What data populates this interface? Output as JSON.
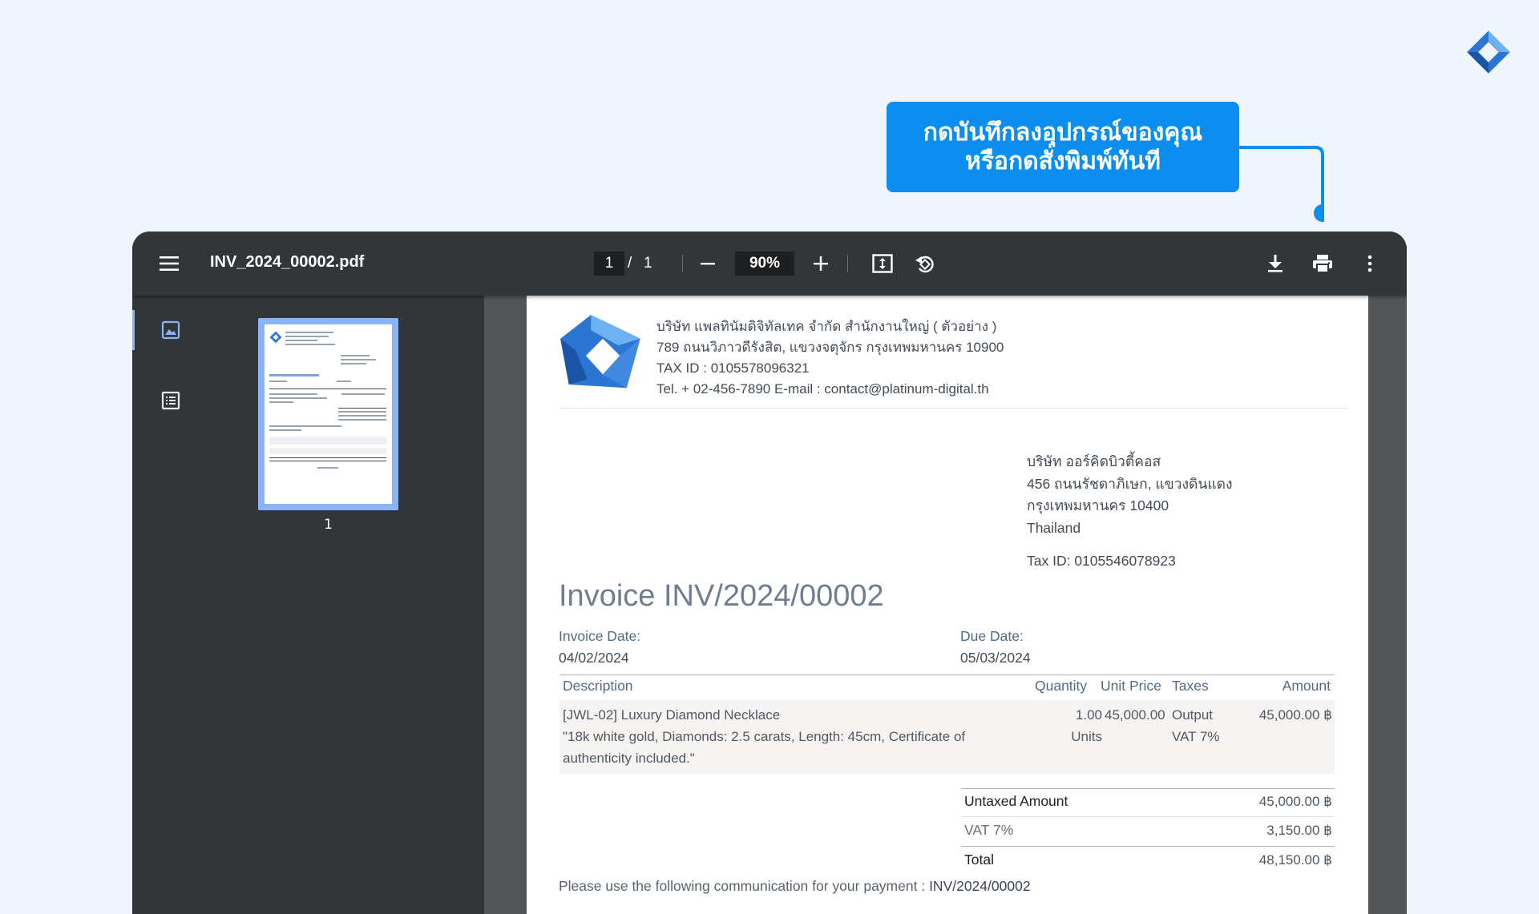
{
  "callout": {
    "line1": "กดบันทึกลงอุปกรณ์ของคุณ",
    "line2": "หรือกดสั่งพิมพ์ทันที"
  },
  "viewer": {
    "filename": "INV_2024_00002.pdf",
    "current_page": "1",
    "page_separator": "/",
    "total_pages": "1",
    "zoom": "90%",
    "thumbnail_label": "1"
  },
  "invoice": {
    "company": {
      "name": "บริษัท แพลทินัมดิจิทัลเทค จำกัด สำนักงานใหญ่ ( ตัวอย่าง )",
      "address": "789 ถนนวิภาวดีรังสิต, แขวงจตุจักร กรุงเทพมหานคร 10900",
      "tax": "TAX ID : 0105578096321",
      "contact": "Tel. + 02-456-7890  E-mail : contact@platinum-digital.th"
    },
    "customer": {
      "name": "บริษัท ออร์คิดบิวตี้คอส",
      "address1": "456 ถนนรัชดาภิเษก, แขวงดินแดง",
      "address2": "กรุงเทพมหานคร 10400",
      "country": "Thailand",
      "tax": "Tax ID: 0105546078923"
    },
    "title": "Invoice INV/2024/00002",
    "invoice_date_label": "Invoice Date:",
    "invoice_date": "04/02/2024",
    "due_date_label": "Due Date:",
    "due_date": "05/03/2024",
    "columns": {
      "description": "Description",
      "quantity": "Quantity",
      "unit_price": "Unit Price",
      "taxes": "Taxes",
      "amount": "Amount"
    },
    "line": {
      "desc1": "[JWL-02] Luxury Diamond Necklace",
      "desc2": "\"18k white gold, Diamonds: 2.5 carats, Length: 45cm, Certificate of",
      "desc3": "authenticity included.\"",
      "qty": "1.00",
      "qty_unit": "Units",
      "unit_price": "45,000.00",
      "tax1": "Output",
      "tax2": "VAT 7%",
      "amount": "45,000.00 ฿"
    },
    "totals": {
      "untaxed_label": "Untaxed Amount",
      "untaxed": "45,000.00 ฿",
      "vat_label": "VAT 7%",
      "vat": "3,150.00 ฿",
      "total_label": "Total",
      "total": "48,150.00 ฿"
    },
    "payment_note": "Please use the following communication for your payment :",
    "payment_ref": "INV/2024/00002"
  },
  "colors": {
    "accent": "#0b8ef0",
    "viewer_bg": "#323639",
    "thumb_highlight": "#8ab4f8"
  }
}
